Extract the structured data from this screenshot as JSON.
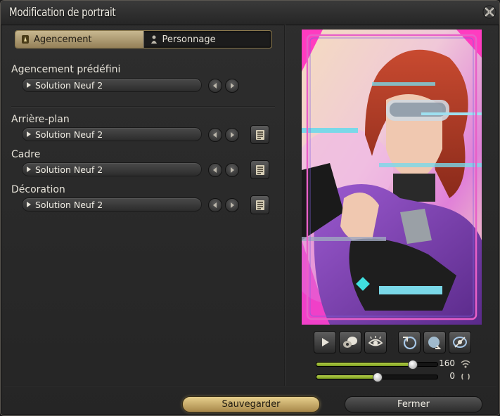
{
  "window": {
    "title": "Modification de portrait",
    "close_icon": "close-cross-icon"
  },
  "tabs": [
    {
      "label": "Agencement",
      "icon": "layout-icon",
      "active": true
    },
    {
      "label": "Personnage",
      "icon": "character-icon",
      "active": false
    }
  ],
  "sections": {
    "preset": {
      "label": "Agencement prédéfini",
      "value": "Solution Neuf 2"
    },
    "background": {
      "label": "Arrière-plan",
      "value": "Solution Neuf 2"
    },
    "frame": {
      "label": "Cadre",
      "value": "Solution Neuf 2"
    },
    "decoration": {
      "label": "Décoration",
      "value": "Solution Neuf 2"
    }
  },
  "controls": {
    "buttons": [
      "play-icon",
      "chat-expression-icon",
      "eye-icon",
      "rotate-left-icon",
      "rotate-right-icon",
      "reset-view-icon"
    ]
  },
  "sliders": [
    {
      "name": "zoom",
      "value": "160",
      "fraction": 0.79,
      "icon": "zoom-level-icon"
    },
    {
      "name": "rotation",
      "value": "0",
      "fraction": 0.5,
      "icon": "rotation-icon"
    }
  ],
  "footer": {
    "save_label": "Sauvegarder",
    "close_label": "Fermer"
  },
  "colors": {
    "accent_gold": "#c8b890",
    "slider_fill": "#9ab832",
    "portrait_frame": "#e860c8"
  }
}
